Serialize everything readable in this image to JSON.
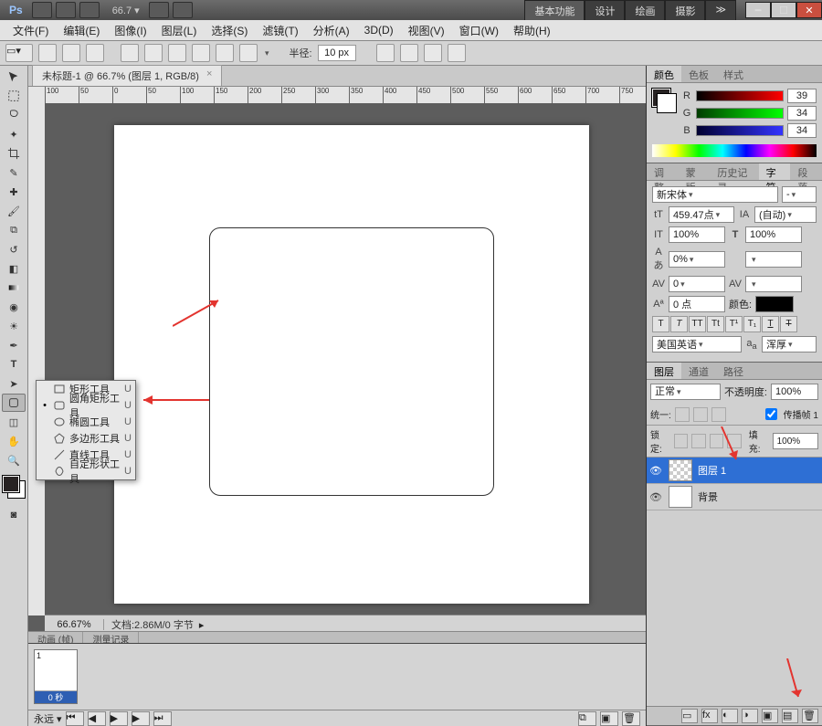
{
  "title_zoom": "66.7",
  "workspace_tabs": [
    "基本功能",
    "设计",
    "绘画",
    "摄影"
  ],
  "workspace_active": 0,
  "menu": [
    "文件(F)",
    "编辑(E)",
    "图像(I)",
    "图层(L)",
    "选择(S)",
    "滤镜(T)",
    "分析(A)",
    "3D(D)",
    "视图(V)",
    "窗口(W)",
    "帮助(H)"
  ],
  "options": {
    "radius_label": "半径:",
    "radius_value": "10 px"
  },
  "doc_tab": {
    "title": "未标题-1 @ 66.7% (图层 1, RGB/8)",
    "close": "×"
  },
  "ruler_marks": [
    "100",
    "50",
    "0",
    "50",
    "100",
    "150",
    "200",
    "250",
    "300",
    "350",
    "400",
    "450",
    "500",
    "550",
    "600",
    "650",
    "700",
    "750"
  ],
  "flyout": {
    "items": [
      {
        "label": "矩形工具",
        "key": "U",
        "icon": "rect"
      },
      {
        "label": "圆角矩形工具",
        "key": "U",
        "icon": "roundrect",
        "active": true
      },
      {
        "label": "椭圆工具",
        "key": "U",
        "icon": "ellipse"
      },
      {
        "label": "多边形工具",
        "key": "U",
        "icon": "polygon"
      },
      {
        "label": "直线工具",
        "key": "U",
        "icon": "line"
      },
      {
        "label": "自定形状工具",
        "key": "U",
        "icon": "custom"
      }
    ]
  },
  "status": {
    "zoom": "66.67%",
    "doc": "文档:2.86M/0 字节"
  },
  "bottom_tabs": [
    "动画 (帧)",
    "测量记录"
  ],
  "timeline": {
    "frame_num": "1",
    "duration": "0 秒",
    "loop": "永远"
  },
  "color": {
    "tabs": [
      "颜色",
      "色板",
      "样式"
    ],
    "r": "39",
    "g": "34",
    "b": "34"
  },
  "history_tabs": [
    "调整",
    "蒙版",
    "历史记录",
    "字符",
    "段落"
  ],
  "character": {
    "font": "新宋体",
    "style": "-",
    "size": "459.47点",
    "leading": "(自动)",
    "vscale": "100%",
    "hscale": "100%",
    "tracking": "0%",
    "kerning": "0",
    "baseline": "0 点",
    "color_label": "颜色:",
    "lang": "美国英语",
    "aa": "浑厚"
  },
  "layers": {
    "tabs": [
      "图层",
      "通道",
      "路径"
    ],
    "mode": "正常",
    "opacity_label": "不透明度:",
    "opacity": "100%",
    "unify_label": "统一:",
    "propagate": "传播帧 1",
    "lock_label": "锁定:",
    "fill_label": "填充:",
    "fill": "100%",
    "items": [
      {
        "name": "图层 1",
        "selected": true,
        "trans": true
      },
      {
        "name": "背景",
        "selected": false,
        "trans": false
      }
    ]
  },
  "tool_names": [
    "move",
    "rect-marquee",
    "lasso",
    "magic-wand",
    "crop",
    "eyedropper",
    "healing",
    "brush",
    "clone",
    "history-brush",
    "eraser",
    "gradient",
    "blur",
    "dodge",
    "pen",
    "type",
    "path-select",
    "shape",
    "3d",
    "hand",
    "zoom"
  ]
}
